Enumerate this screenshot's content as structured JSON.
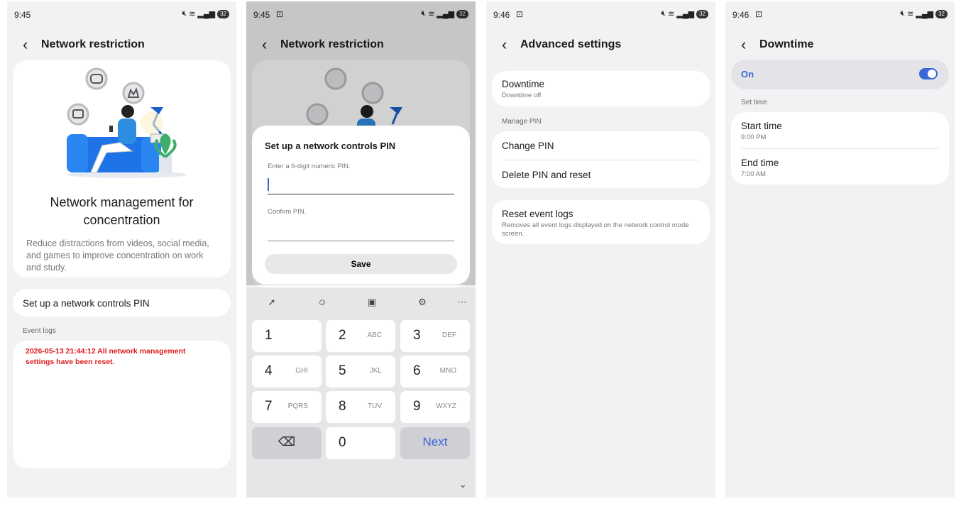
{
  "screens": {
    "s1": {
      "time": "9:45",
      "battery": "32",
      "title": "Network restriction",
      "heading": "Network management for concentration",
      "description": "Reduce distractions from videos, social media, and games to improve concentration on work and study.",
      "setup_pin": "Set up a network controls PIN",
      "event_logs_label": "Event logs",
      "log_entry": "2026-05-13 21:44:12 All network management settings have been reset."
    },
    "s2": {
      "time": "9:45",
      "battery": "32",
      "title": "Network restriction",
      "dialog": {
        "title": "Set up a network controls PIN",
        "pin_hint": "Enter a 6-digit numeric PIN.",
        "confirm_hint": "Confirm PIN.",
        "save": "Save"
      },
      "keyboard": {
        "keys": [
          {
            "d": "1",
            "l": ""
          },
          {
            "d": "2",
            "l": "ABC"
          },
          {
            "d": "3",
            "l": "DEF"
          },
          {
            "d": "4",
            "l": "GHI"
          },
          {
            "d": "5",
            "l": "JKL"
          },
          {
            "d": "6",
            "l": "MNO"
          },
          {
            "d": "7",
            "l": "PQRS"
          },
          {
            "d": "8",
            "l": "TUV"
          },
          {
            "d": "9",
            "l": "WXYZ"
          }
        ],
        "zero": "0",
        "next": "Next"
      }
    },
    "s3": {
      "time": "9:46",
      "battery": "32",
      "title": "Advanced settings",
      "downtime": "Downtime",
      "downtime_sub": "Downtime off",
      "manage_pin": "Manage PIN",
      "change_pin": "Change PIN",
      "delete_pin": "Delete PIN and reset",
      "reset_logs": "Reset event logs",
      "reset_logs_sub": "Removes all event logs displayed on the network control mode screen."
    },
    "s4": {
      "time": "9:46",
      "battery": "32",
      "title": "Downtime",
      "toggle_label": "On",
      "toggle_on": true,
      "set_time": "Set time",
      "start_time": "Start time",
      "start_value": "9:00 PM",
      "end_time": "End time",
      "end_value": "7:00 AM"
    }
  },
  "colors": {
    "accent": "#3a67d6",
    "log_red": "#e01b1b",
    "background": "#f2f2f4"
  }
}
